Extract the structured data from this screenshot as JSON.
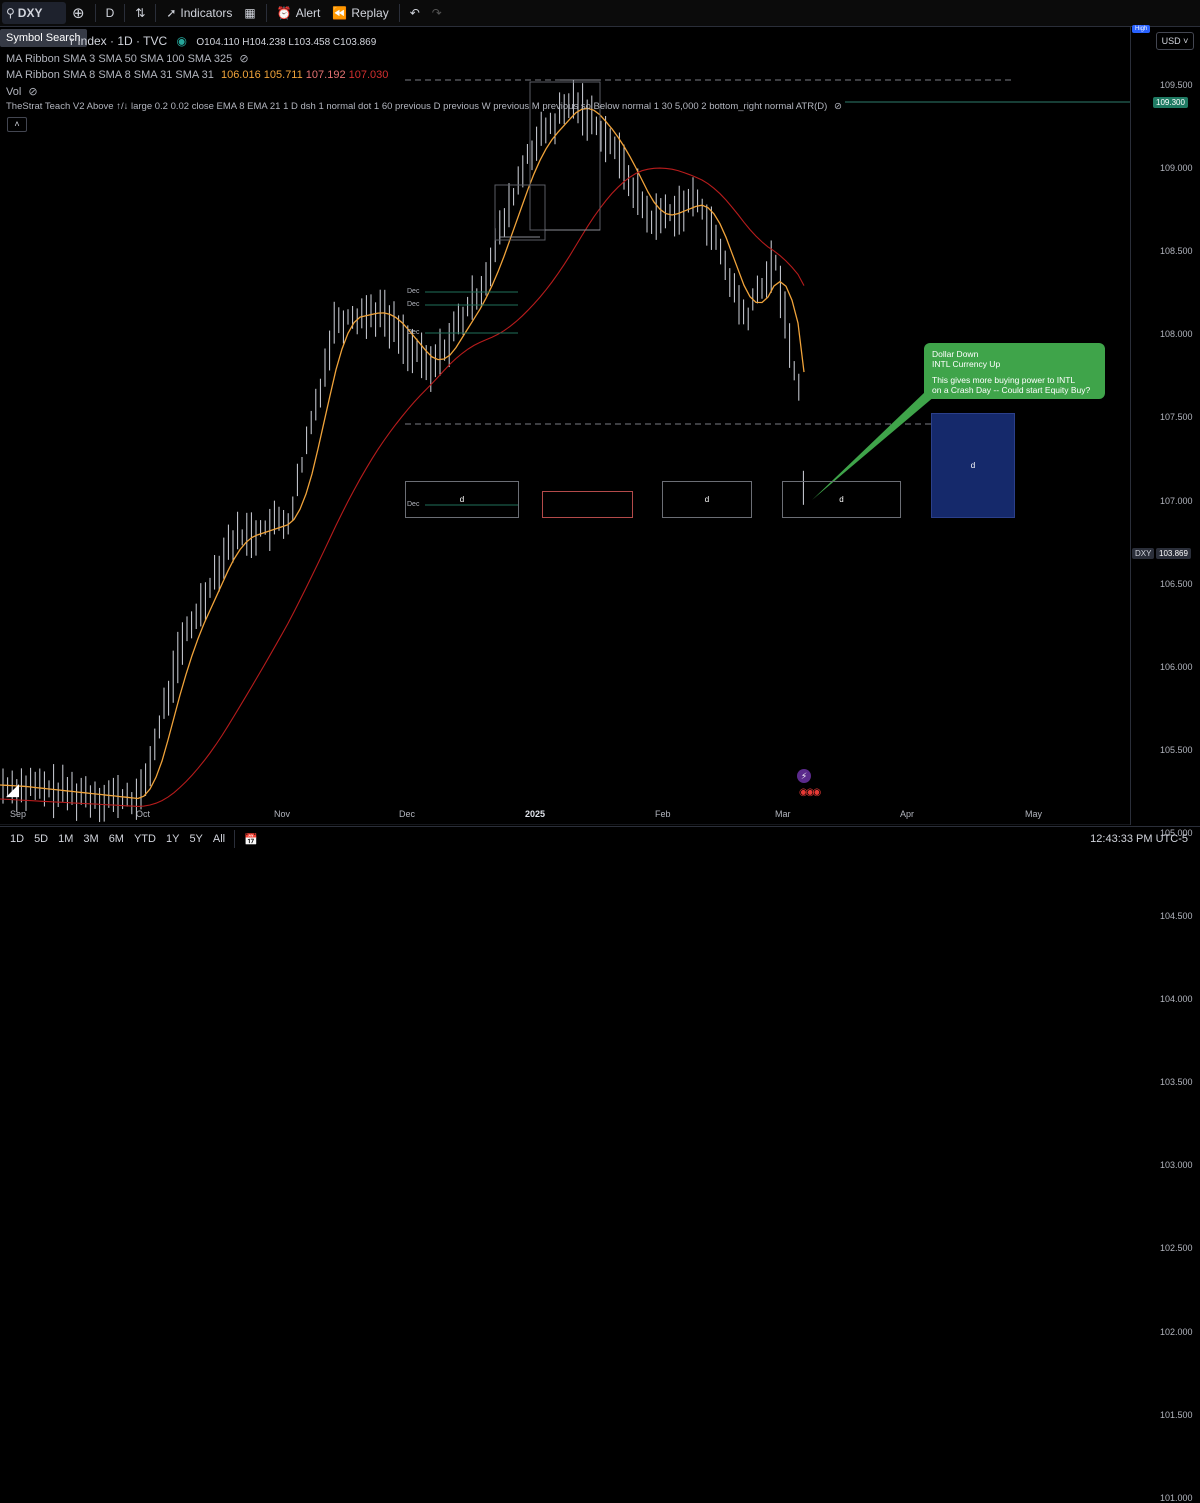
{
  "toolbar": {
    "symbol": "DXY",
    "interval": "D",
    "indicators_label": "Indicators",
    "alert_label": "Alert",
    "replay_label": "Replay",
    "symbol_search_tooltip": "Symbol Search"
  },
  "legend": {
    "title_fragment": "r Index · 1D · TVC",
    "ohlc": "O104.110 H104.238 L103.458 C103.869",
    "ma_ribbon_1": "MA Ribbon SMA 3 SMA 50 SMA 100 SMA 325",
    "ma_ribbon_2_label": "MA Ribbon SMA 8 SMA 8 SMA 31 SMA 31",
    "ma_ribbon_2_values": [
      "106.016",
      "105.711",
      "107.192",
      "107.030"
    ],
    "vol_label": "Vol",
    "strat_label": "TheStrat Teach V2 Above ↑/↓ large 0.2 0.02 close EMA 8 EMA 21 1 D dsh 1 normal dot 1 60 previous D previous W previous M previous so Below normal 1 30 5,000 2 bottom_right normal ATR(D)"
  },
  "price_scale": {
    "currency": "USD",
    "labels": [
      "109.500",
      "109.000",
      "108.500",
      "108.000",
      "107.500",
      "107.000",
      "106.500",
      "106.000",
      "105.500",
      "105.000",
      "104.500",
      "104.000",
      "103.500",
      "103.000",
      "102.500",
      "102.000",
      "101.500",
      "101.000"
    ],
    "highlight_level": "109.300",
    "current_symbol": "DXY",
    "current_price": "103.869",
    "top_tag": "High"
  },
  "time_axis": [
    "Sep",
    "Oct",
    "Nov",
    "Dec",
    "2025",
    "Feb",
    "Mar",
    "Apr",
    "May"
  ],
  "bottom_bar": {
    "ranges": [
      "1D",
      "5D",
      "1M",
      "3M",
      "6M",
      "YTD",
      "1Y",
      "5Y",
      "All"
    ],
    "clock": "12:43:33 PM UTC-5"
  },
  "annotations": {
    "dec_labels": [
      "Dec",
      "Dec",
      "Dec",
      "Dec"
    ],
    "box_labels": [
      "d",
      "d",
      "d",
      "d"
    ],
    "callout_lines": [
      "Dollar Down",
      "INTL Currency Up",
      "",
      "This gives more buying power to INTL",
      "on a Crash Day -- Could start Equity Buy?"
    ]
  },
  "colors": {
    "up": "#d1d4dc",
    "ema_fast": "#f0a33a",
    "ema_mid": "#d26a2b",
    "ema_slow": "#d32f2f",
    "callout": "#3fa44a",
    "blue_box": "#15296b"
  }
}
